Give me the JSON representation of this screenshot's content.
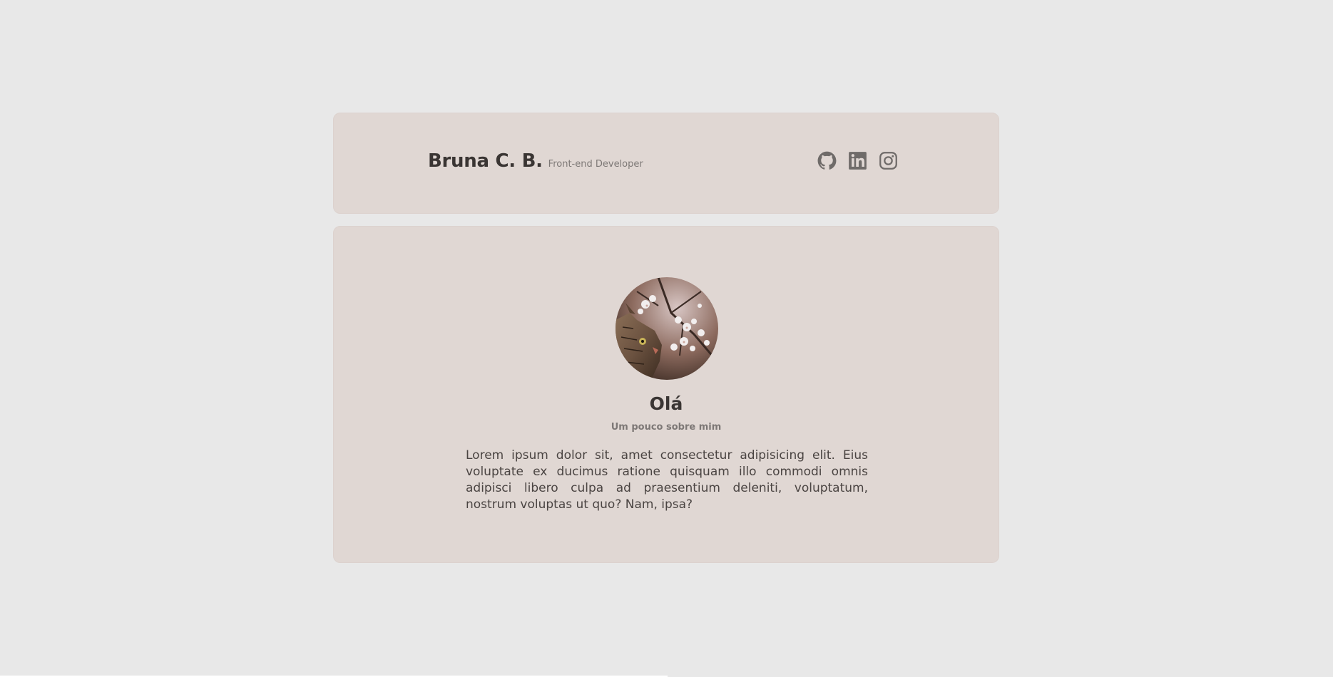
{
  "header": {
    "name": "Bruna C. B.",
    "role": "Front-end Developer",
    "socials": [
      {
        "icon": "github-icon",
        "label": "GitHub"
      },
      {
        "icon": "linkedin-icon",
        "label": "LinkedIn"
      },
      {
        "icon": "instagram-icon",
        "label": "Instagram"
      }
    ]
  },
  "profile": {
    "avatar_icon": "cat-photo",
    "greeting": "Olá",
    "subtitle": "Um pouco sobre mim",
    "bio": "Lorem ipsum dolor sit, amet consectetur adipisicing elit. Eius voluptate ex ducimus ratione quisquam illo commodi omnis adipisci libero culpa ad praesentium deleniti, voluptatum, nostrum voluptas ut quo? Nam, ipsa?"
  },
  "colors": {
    "background": "#e8e8e8",
    "card": "#e0d7d3",
    "text": "#3a3533",
    "muted": "#7d7876",
    "icon": "#6f6b69"
  }
}
